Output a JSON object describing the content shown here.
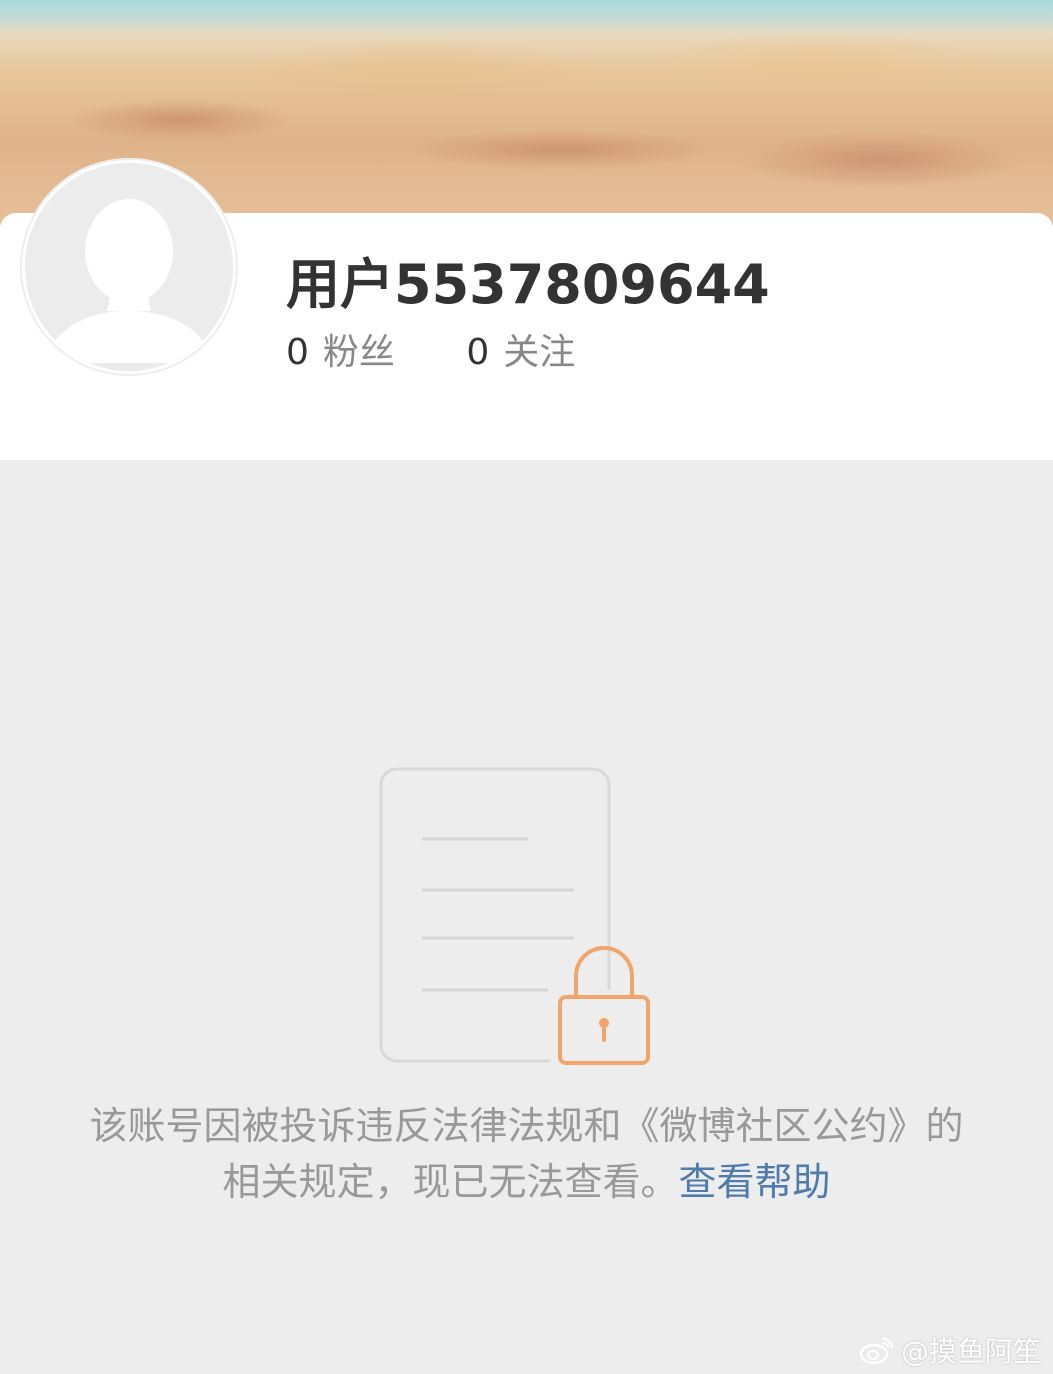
{
  "profile": {
    "username": "用户5537809644",
    "followers_count": "0",
    "followers_label": "粉丝",
    "following_count": "0",
    "following_label": "关注"
  },
  "notice": {
    "message": "该账号因被投诉违反法律法规和《微博社区公约》的相关规定，现已无法查看。",
    "help_link": "查看帮助"
  },
  "watermark": {
    "text": "@摸鱼阿笙",
    "icon": "weibo-logo-icon"
  },
  "colors": {
    "link": "#4f7cad",
    "lock": "#f2a56a",
    "background": "#ededed"
  }
}
